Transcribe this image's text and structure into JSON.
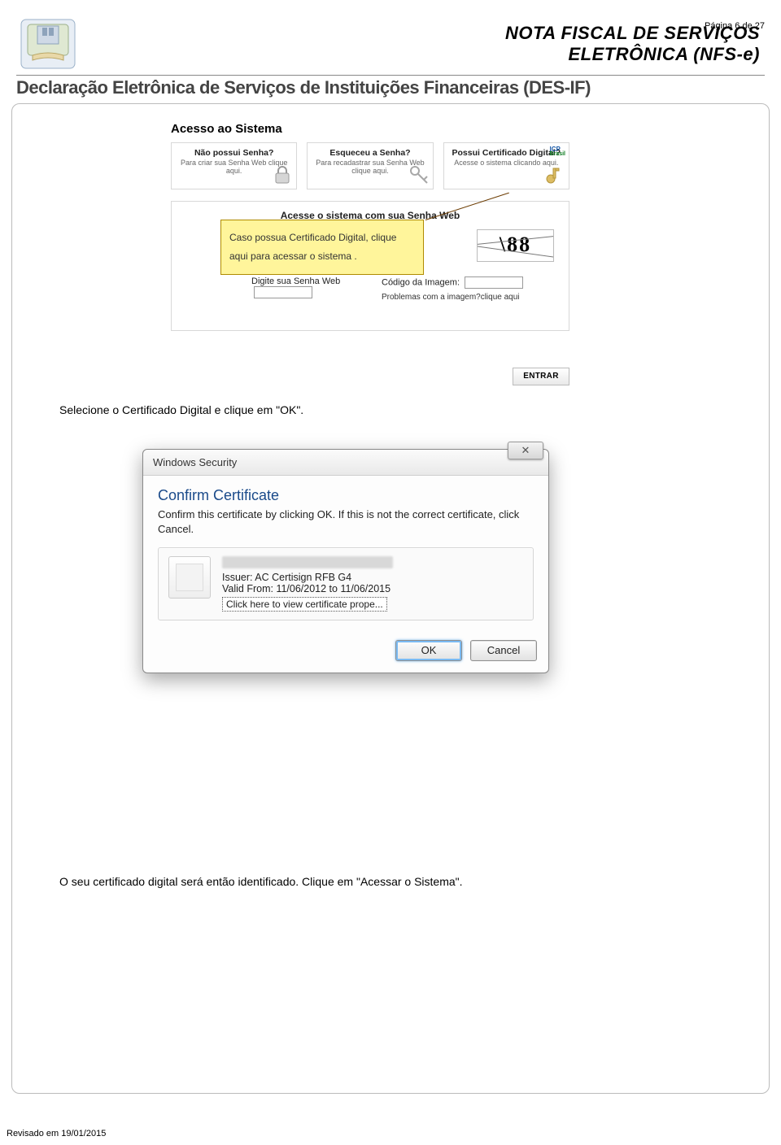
{
  "page_number": "Página 6 de 27",
  "header": {
    "title_line1": "NOTA FISCAL DE SERVIÇOS",
    "title_line2": "ELETRÔNICA (NFS-e)",
    "subtitle": "Declaração Eletrônica de Serviços de Instituições Financeiras (DES-IF)"
  },
  "footer": {
    "revised": "Revisado em 19/01/2015"
  },
  "body": {
    "para1": "Selecione o Certificado Digital e clique em \"OK\".",
    "para2": "O seu certificado digital será então identificado. Clique em \"Acessar o Sistema\"."
  },
  "screenshot1": {
    "title": "Acesso ao Sistema",
    "cards": [
      {
        "title": "Não possui Senha?",
        "sub": "Para criar sua Senha Web clique aqui."
      },
      {
        "title": "Esqueceu a Senha?",
        "sub": "Para recadastrar sua Senha Web clique aqui."
      },
      {
        "title": "Possui Certificado Digital?",
        "sub": "Acesse o sistema clicando aqui."
      }
    ],
    "icp": {
      "top": "ICP",
      "bottom": "Brasil"
    },
    "login_title": "Acesse o sistema com sua Senha Web",
    "callout": "Caso possua Certificado Digital, clique aqui para acessar o sistema .",
    "captcha_value": "\\88",
    "senha_label": "Digite sua Senha Web",
    "code_label": "Código da Imagem:",
    "help": "Problemas com a imagem?clique aqui",
    "entrar": "ENTRAR"
  },
  "dialog": {
    "title": "Windows Security",
    "close_glyph": "✕",
    "heading": "Confirm Certificate",
    "message": "Confirm this certificate by clicking OK. If this is not the correct certificate, click Cancel.",
    "issuer": "Issuer: AC Certisign RFB G4",
    "valid": "Valid From: 11/06/2012 to 11/06/2015",
    "view_link": "Click here to view certificate prope...",
    "ok": "OK",
    "cancel": "Cancel"
  }
}
